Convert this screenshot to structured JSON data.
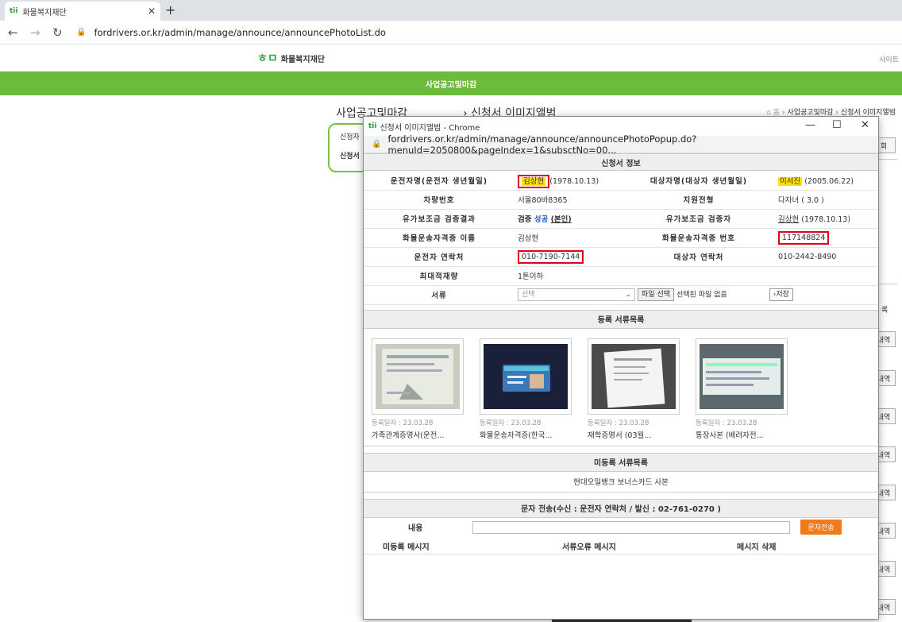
{
  "browser": {
    "tab_title": "화물복지재단",
    "tab_favicon": "tii",
    "url": "fordrivers.or.kr/admin/manage/announce/announcePhotoList.do"
  },
  "site": {
    "logo_text": "화물복지재단",
    "sitemap": "사이트",
    "green_bar": "사업공고및마감",
    "page_title": "사업공고및마감",
    "page_title2": "› 신청서 이미지앨범",
    "breadcrumb_home": "홈",
    "breadcrumb_1": "사업공고및마감",
    "breadcrumb_2": "신청서 이미지앨범",
    "side_label1": "신청자",
    "side_label2": "신청서",
    "right_btn": "회",
    "right_lbl": "록",
    "right_btn_history": "내역"
  },
  "popup": {
    "title": "신청서 이미지앨범 - Chrome",
    "url": "fordrivers.or.kr/admin/manage/announce/announcePhotoPopup.do?menuId=2050800&pageIndex=1&subsctNo=00...",
    "section_info": "신청서 정보",
    "rows": {
      "driver_label": "운전자명(운전자 생년월일)",
      "driver_name": "김상현",
      "driver_birth": "(1978.10.13)",
      "target_label": "대상자명(대상자 생년월일)",
      "target_name": "이서진",
      "target_birth": "(2005.06.22)",
      "car_label": "차량번호",
      "car_value": "서울80바8365",
      "support_label": "지원전형",
      "support_value": "다자녀 ( 3.0 )",
      "verify_label": "유가보조금 검증결과",
      "verify_prefix": "검증",
      "verify_success": "성공",
      "verify_self": "(본인)",
      "verifier_label": "유가보조금 검증자",
      "verifier_name": "김상현",
      "verifier_birth": "(1978.10.13)",
      "license_name_label": "화물운송자격증 이름",
      "license_name": "김상현",
      "license_no_label": "화물운송자격증 번호",
      "license_no": "117148824",
      "driver_phone_label": "운전자 연락처",
      "driver_phone": "010-7190-7144",
      "target_phone_label": "대상자 연락처",
      "target_phone": "010-2442-8490",
      "max_load_label": "최대적재량",
      "max_load": "1톤이하",
      "doc_label": "서류",
      "doc_select": "선택",
      "file_btn": "파일 선택",
      "file_none": "선택된 파일 없음",
      "save_btn": "›저장"
    },
    "section_registered": "등록 서류목록",
    "documents": [
      {
        "date": "등록일자 : 23.03.28",
        "name": "가족관계증명서(운전..."
      },
      {
        "date": "등록일자 : 23.03.28",
        "name": "화물운송자격증(한국..."
      },
      {
        "date": "등록일자 : 23.03.28",
        "name": "재학증명서 (03월..."
      },
      {
        "date": "등록일자 : 23.03.28",
        "name": "통장사본 (배려자전..."
      }
    ],
    "section_unregistered": "미등록 서류목록",
    "unregistered_item": "현대오일뱅크 보너스카드 사본",
    "section_sms": "문자 전송(수신 : 운전자 연락처 / 발신 : 02-761-0270 )",
    "sms_label": "내용",
    "sms_btn": "문자전송",
    "msg_headers": [
      "미등록 메시지",
      "서류오류 메시지",
      "메시지 삭제"
    ]
  }
}
